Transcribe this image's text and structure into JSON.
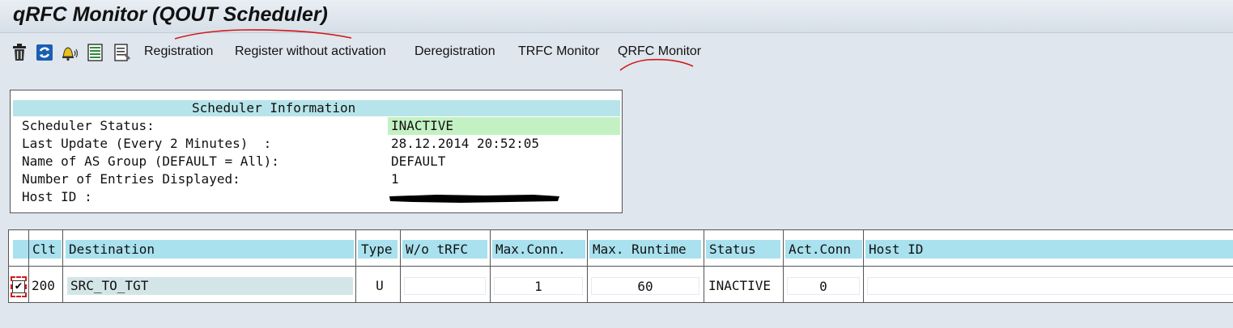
{
  "window": {
    "title": "qRFC Monitor (QOUT Scheduler)"
  },
  "toolbar": {
    "icons": [
      "delete-icon",
      "refresh-icon",
      "alert-bell-icon",
      "list-icon",
      "details-icon"
    ],
    "buttons": [
      "Registration",
      "Register without activation",
      "Deregistration",
      "TRFC Monitor",
      "QRFC Monitor"
    ]
  },
  "scheduler_info": {
    "header": "Scheduler Information",
    "rows": [
      {
        "label": "Scheduler Status:",
        "value": "INACTIVE"
      },
      {
        "label": "Last Update (Every 2 Minutes)  :",
        "value": "28.12.2014 20:52:05"
      },
      {
        "label": "Name of AS Group (DEFAULT = All):",
        "value": "DEFAULT"
      },
      {
        "label": "Number of Entries Displayed:",
        "value": "1"
      },
      {
        "label": "Host ID :",
        "value": ""
      }
    ]
  },
  "table": {
    "columns": [
      "Clt",
      "Destination",
      "Type",
      "W/o tRFC",
      "Max.Conn.",
      "Max. Runtime",
      "Status",
      "Act.Conn",
      "Host ID"
    ],
    "rows": [
      {
        "selected": true,
        "clt": "200",
        "destination": "SRC_TO_TGT",
        "type": "U",
        "wo_trfc": "",
        "max_conn": "1",
        "max_runtime": "60",
        "status": "INACTIVE",
        "act_conn": "0",
        "host_id": ""
      }
    ]
  },
  "colors": {
    "header_cell": "#a9e1ee",
    "status_inactive_bg": "#c3f1c3",
    "annotation_red": "#d21a1a"
  }
}
